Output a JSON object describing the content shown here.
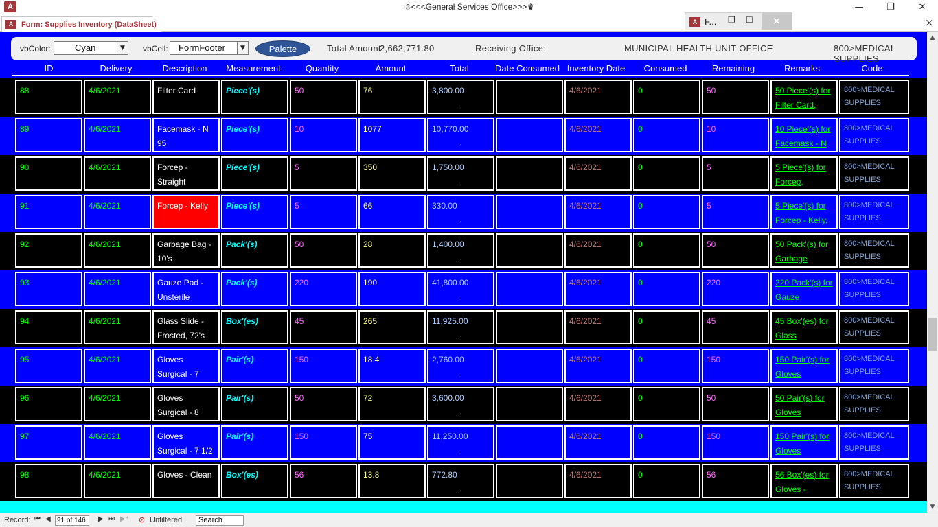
{
  "window": {
    "app_icon": "A",
    "title": "☃<<<General Services Office>>>♛"
  },
  "tab": {
    "icon": "A",
    "label": "Form: Supplies Inventory (DataSheet)",
    "close": "×"
  },
  "mini_window": {
    "icon": "A",
    "label": "F...",
    "close": "✕"
  },
  "header": {
    "vbcolor_label": "vbColor:",
    "vbcolor_value": "Cyan",
    "vbcell_label": "vbCell:",
    "vbcell_value": "FormFooter",
    "palette_label": "Palette",
    "total_label": "Total Amount:",
    "total_value": "2,662,771.80",
    "office_label": "Receiving Office:",
    "office_value": "MUNICIPAL HEALTH UNIT OFFICE",
    "code_value": "800>MEDICAL SUPPLIES"
  },
  "columns": [
    "ID",
    "Delivery",
    "Description",
    "Measurement",
    "Quantity",
    "Amount",
    "Total",
    "Date Consumed",
    "Inventory Date",
    "Consumed",
    "Remaining",
    "Remarks",
    "Code"
  ],
  "rows": [
    {
      "id": "88",
      "delivery": "4/6/2021",
      "description": "Filter Card",
      "measurement": "Piece'(s)",
      "quantity": "50",
      "amount": "76",
      "total": "3,800.00",
      "date_consumed": "",
      "inventory_date": "4/6/2021",
      "consumed": "0",
      "remaining": "50",
      "remarks": "50 Piece'(s) for Filter Card,",
      "code": "800>MEDICAL SUPPLIES",
      "dark": true,
      "highlight": false
    },
    {
      "id": "89",
      "delivery": "4/6/2021",
      "description": "Facemask - N 95",
      "measurement": "Piece'(s)",
      "quantity": "10",
      "amount": "1077",
      "total": "10,770.00",
      "date_consumed": "",
      "inventory_date": "4/6/2021",
      "consumed": "0",
      "remaining": "10",
      "remarks": "10 Piece'(s) for Facemask - N",
      "code": "800>MEDICAL SUPPLIES",
      "dark": false,
      "highlight": false
    },
    {
      "id": "90",
      "delivery": "4/6/2021",
      "description": "Forcep - Straight",
      "measurement": "Piece'(s)",
      "quantity": "5",
      "amount": "350",
      "total": "1,750.00",
      "date_consumed": "",
      "inventory_date": "4/6/2021",
      "consumed": "0",
      "remaining": "5",
      "remarks": "5 Piece'(s) for Forcep,",
      "code": "800>MEDICAL SUPPLIES",
      "dark": true,
      "highlight": false
    },
    {
      "id": "91",
      "delivery": "4/6/2021",
      "description": "Forcep - Kelly",
      "measurement": "Piece'(s)",
      "quantity": "5",
      "amount": "66",
      "total": "330.00",
      "date_consumed": "",
      "inventory_date": "4/6/2021",
      "consumed": "0",
      "remaining": "5",
      "remarks": "5 Piece'(s) for Forcep - Kelly,",
      "code": "800>MEDICAL SUPPLIES",
      "dark": false,
      "highlight": true
    },
    {
      "id": "92",
      "delivery": "4/6/2021",
      "description": "Garbage Bag - 10's",
      "measurement": "Pack'(s)",
      "quantity": "50",
      "amount": "28",
      "total": "1,400.00",
      "date_consumed": "",
      "inventory_date": "4/6/2021",
      "consumed": "0",
      "remaining": "50",
      "remarks": "50 Pack'(s) for Garbage",
      "code": "800>MEDICAL SUPPLIES",
      "dark": true,
      "highlight": false
    },
    {
      "id": "93",
      "delivery": "4/6/2021",
      "description": "Gauze Pad - Unsterile",
      "measurement": "Pack'(s)",
      "quantity": "220",
      "amount": "190",
      "total": "41,800.00",
      "date_consumed": "",
      "inventory_date": "4/6/2021",
      "consumed": "0",
      "remaining": "220",
      "remarks": "220 Pack'(s) for Gauze",
      "code": "800>MEDICAL SUPPLIES",
      "dark": false,
      "highlight": false
    },
    {
      "id": "94",
      "delivery": "4/6/2021",
      "description": "Glass Slide - Frosted, 72's",
      "measurement": "Box'(es)",
      "quantity": "45",
      "amount": "265",
      "total": "11,925.00",
      "date_consumed": "",
      "inventory_date": "4/6/2021",
      "consumed": "0",
      "remaining": "45",
      "remarks": "45 Box'(es) for Glass",
      "code": "800>MEDICAL SUPPLIES",
      "dark": true,
      "highlight": false
    },
    {
      "id": "95",
      "delivery": "4/6/2021",
      "description": "Gloves Surgical - 7",
      "measurement": "Pair'(s)",
      "quantity": "150",
      "amount": "18.4",
      "total": "2,760.00",
      "date_consumed": "",
      "inventory_date": "4/6/2021",
      "consumed": "0",
      "remaining": "150",
      "remarks": "150 Pair'(s) for Gloves",
      "code": "800>MEDICAL SUPPLIES",
      "dark": false,
      "highlight": false
    },
    {
      "id": "96",
      "delivery": "4/6/2021",
      "description": "Gloves Surgical - 8",
      "measurement": "Pair'(s)",
      "quantity": "50",
      "amount": "72",
      "total": "3,600.00",
      "date_consumed": "",
      "inventory_date": "4/6/2021",
      "consumed": "0",
      "remaining": "50",
      "remarks": "50 Pair'(s) for Gloves",
      "code": "800>MEDICAL SUPPLIES",
      "dark": true,
      "highlight": false
    },
    {
      "id": "97",
      "delivery": "4/6/2021",
      "description": "Gloves Surgical - 7 1/2",
      "measurement": "Pair'(s)",
      "quantity": "150",
      "amount": "75",
      "total": "11,250.00",
      "date_consumed": "",
      "inventory_date": "4/6/2021",
      "consumed": "0",
      "remaining": "150",
      "remarks": "150 Pair'(s) for Gloves",
      "code": "800>MEDICAL SUPPLIES",
      "dark": false,
      "highlight": false
    },
    {
      "id": "98",
      "delivery": "4/6/2021",
      "description": "Gloves - Clean",
      "measurement": "Box'(es)",
      "quantity": "56",
      "amount": "13.8",
      "total": "772.80",
      "date_consumed": "",
      "inventory_date": "4/6/2021",
      "consumed": "0",
      "remaining": "56",
      "remarks": "56 Box'(es) for Gloves -",
      "code": "800>MEDICAL SUPPLIES",
      "dark": true,
      "highlight": false
    }
  ],
  "navbar": {
    "record_label": "Record:",
    "record_value": "91 of 146",
    "filter_label": "Unfiltered",
    "search_label": "Search"
  },
  "colors": {
    "form_bg": "#0000ff",
    "dark_row": "#000000",
    "highlight_cell": "#ff0000",
    "footer": "#00ffff",
    "access_brand": "#a4373a"
  }
}
